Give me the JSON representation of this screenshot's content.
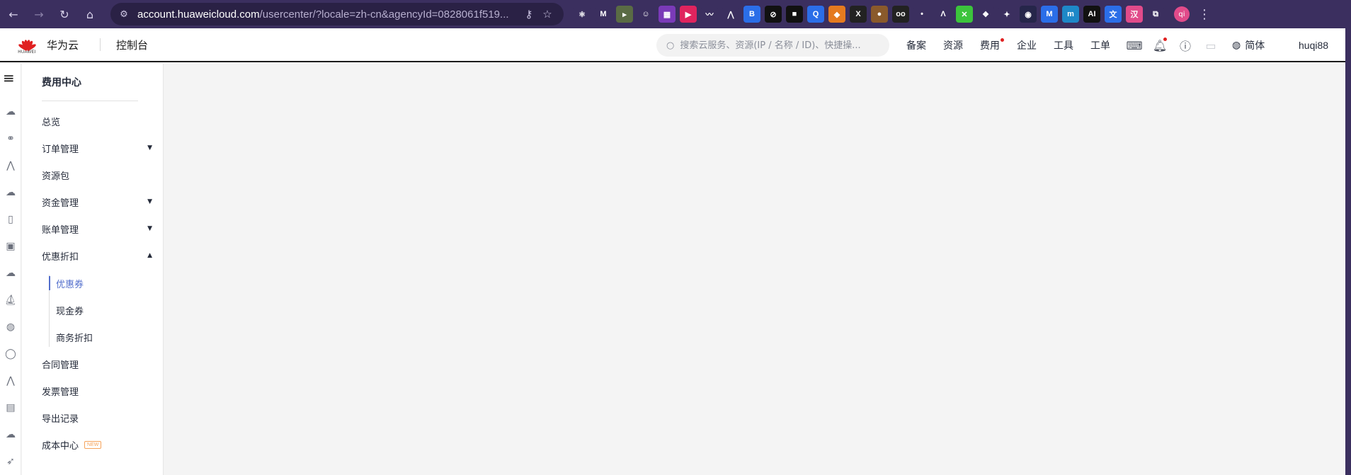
{
  "browser": {
    "url_host": "account.huaweicloud.com",
    "url_path": "/usercenter/?locale=zh-cn&agencyId=0828061f519...",
    "extensions": [
      {
        "name": "react-devtools-icon",
        "glyph": "⚛",
        "color": "#3b2f5f"
      },
      {
        "name": "m-ext-icon",
        "glyph": "M",
        "color": "#3b2f5f"
      },
      {
        "name": "tag-ext-icon",
        "glyph": "▸",
        "color": "#5a6b44"
      },
      {
        "name": "bot-ext-icon",
        "glyph": "☺",
        "color": "#3b2f5f"
      },
      {
        "name": "grid-ext-icon",
        "glyph": "▦",
        "color": "#7a3ab8"
      },
      {
        "name": "play-ext-icon",
        "glyph": "▶",
        "color": "#e0245e"
      },
      {
        "name": "wave-ext-icon",
        "glyph": "〰",
        "color": "#3b2f5f"
      },
      {
        "name": "arrow-ext-icon",
        "glyph": "⋀",
        "color": "#3b2f5f"
      },
      {
        "name": "b-ext-icon",
        "glyph": "B",
        "color": "#2b6ee8"
      },
      {
        "name": "slash-ext-icon",
        "glyph": "⊘",
        "color": "#111111"
      },
      {
        "name": "square-ext-icon",
        "glyph": "■",
        "color": "#111111"
      },
      {
        "name": "q-ext-icon",
        "glyph": "Q",
        "color": "#2b6ee8"
      },
      {
        "name": "fox-ext-icon",
        "glyph": "◆",
        "color": "#e57a1f"
      },
      {
        "name": "x-ext-icon",
        "glyph": "X",
        "color": "#222222"
      },
      {
        "name": "cookie-ext-icon",
        "glyph": "●",
        "color": "#8a5a2b"
      },
      {
        "name": "goggles-ext-icon",
        "glyph": "oo",
        "color": "#222222"
      },
      {
        "name": "dot-ext-icon",
        "glyph": "•",
        "color": "#3b2f5f"
      },
      {
        "name": "a-ext-icon",
        "glyph": "Λ",
        "color": "#3b2f5f"
      },
      {
        "name": "green-ext-icon",
        "glyph": "✕",
        "color": "#3cc43c"
      },
      {
        "name": "leaf-ext-icon",
        "glyph": "❖",
        "color": "#3b2f5f"
      },
      {
        "name": "kite-ext-icon",
        "glyph": "✦",
        "color": "#3b2f5f"
      },
      {
        "name": "circle-ext-icon",
        "glyph": "◉",
        "color": "#26264a"
      },
      {
        "name": "m-blue-ext-icon",
        "glyph": "M",
        "color": "#2b6ee8"
      },
      {
        "name": "m-cyan-ext-icon",
        "glyph": "m",
        "color": "#1e88c8"
      },
      {
        "name": "ai-ext-icon",
        "glyph": "AI",
        "color": "#111111"
      },
      {
        "name": "translate-ext-icon",
        "glyph": "文",
        "color": "#2b6ee8"
      },
      {
        "name": "red-ext-icon",
        "glyph": "汉",
        "color": "#e14b8a"
      },
      {
        "name": "puzzle-icon",
        "glyph": "⧉",
        "color": "#3b2f5f"
      }
    ],
    "profile_initials": "qi"
  },
  "header": {
    "logo_text": "HUAWEI",
    "brand": "华为云",
    "console": "控制台",
    "search_placeholder": "搜索云服务、资源(IP / 名称 / ID)、快捷操...",
    "nav": [
      "备案",
      "资源",
      "费用",
      "企业",
      "工具",
      "工单"
    ],
    "lang": "简体",
    "username": "huqi88"
  },
  "sidebar": {
    "title": "费用中心",
    "items": [
      {
        "label": "总览",
        "caret": ""
      },
      {
        "label": "订单管理",
        "caret": "▼"
      },
      {
        "label": "资源包",
        "caret": ""
      },
      {
        "label": "资金管理",
        "caret": "▼"
      },
      {
        "label": "账单管理",
        "caret": "▼"
      },
      {
        "label": "优惠折扣",
        "caret": "▲"
      }
    ],
    "sub_items": [
      {
        "label": "优惠券",
        "active": true
      },
      {
        "label": "现金券",
        "active": false
      },
      {
        "label": "商务折扣",
        "active": false
      }
    ],
    "items_after": [
      {
        "label": "合同管理"
      },
      {
        "label": "发票管理"
      },
      {
        "label": "导出记录"
      },
      {
        "label": "成本中心",
        "badge": "NEW"
      }
    ]
  },
  "colors": {
    "accent": "#526ecc",
    "brand_red": "#e02020",
    "chrome_bg": "#3b2f5f",
    "new_badge": "#f5a35b"
  }
}
